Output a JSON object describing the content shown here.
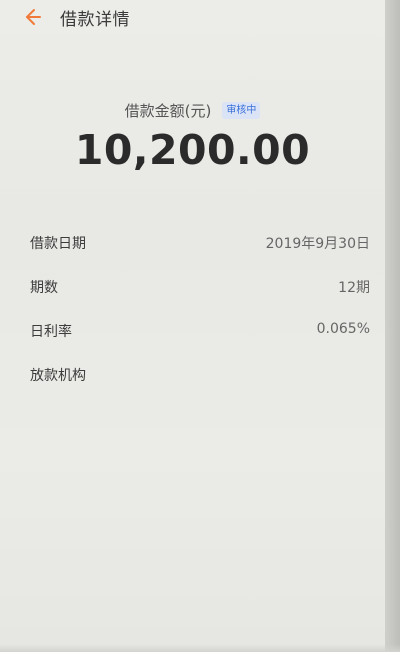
{
  "header": {
    "title": "借款详情",
    "back_icon": "arrow-left-icon",
    "accent_color": "#f07a3a"
  },
  "summary": {
    "amount_label": "借款金额(元)",
    "status_badge": "审核中",
    "amount": "10,200.00"
  },
  "details": [
    {
      "label": "借款日期",
      "value": "2019年9月30日"
    },
    {
      "label": "期数",
      "value": "12期"
    },
    {
      "label": "日利率",
      "value": "0.065%"
    },
    {
      "label": "放款机构",
      "value": ""
    }
  ]
}
